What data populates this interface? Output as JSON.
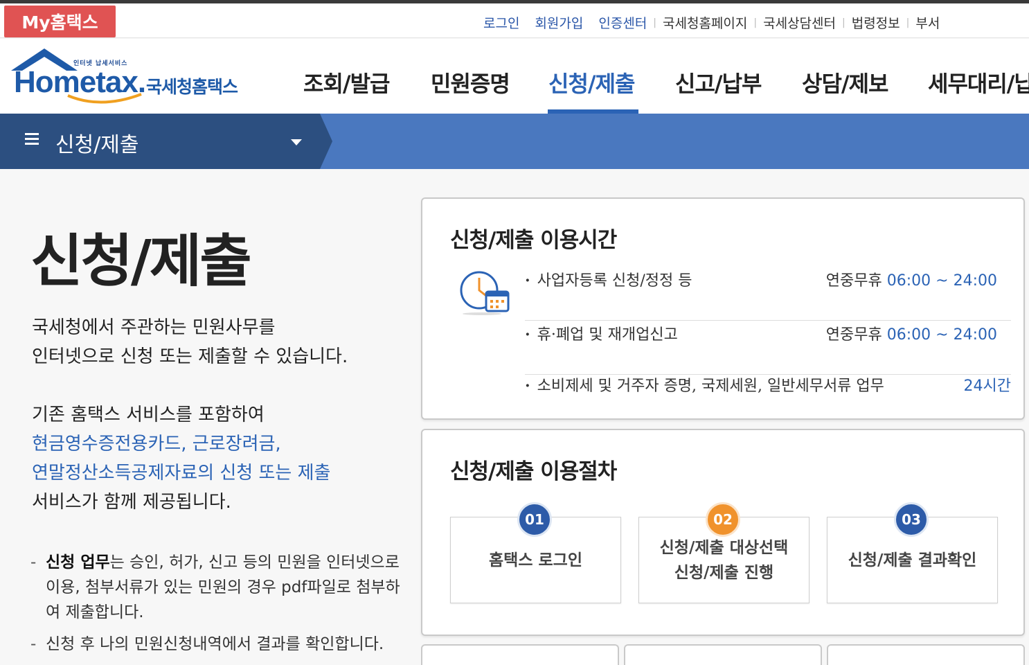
{
  "util": {
    "my_hometax": "My홈택스",
    "links_blue": [
      "로그인",
      "회원가입",
      "인증센터"
    ],
    "links_gray": [
      "국세청홈페이지",
      "국세상담센터",
      "법령정보",
      "부서"
    ]
  },
  "logo": {
    "small_text": "인터넷 납세서비스",
    "brand_en": "Hometax.",
    "brand_kr": "국세청홈택스"
  },
  "gnb": {
    "items": [
      "조회/발급",
      "민원증명",
      "신청/제출",
      "신고/납부",
      "상담/제보",
      "세무대리/납"
    ],
    "active_index": 2
  },
  "subbar": {
    "title": "신청/제출",
    "menu_icon": "hamburger-icon",
    "caret_icon": "caret-down-icon"
  },
  "intro": {
    "title": "신청/제출",
    "p1_line1": "국세청에서 주관하는 민원사무를",
    "p1_line2": "인터넷으로 신청 또는 제출할 수 있습니다.",
    "p2_line1": "기존 홈택스 서비스를 포함하여",
    "p2_blue1": "현금영수증전용카드, 근로장려금,",
    "p2_blue2": "연말정산소득공제자료의 신청 또는 제출",
    "p2_line4": "서비스가 함께 제공됩니다.",
    "bullet1_bold": "신청 업무",
    "bullet1_rest": "는 승인, 허가, 신고 등의 민원을 인터넷으로 이용, 첨부서류가 있는 민원의 경우 pdf파일로 첨부하여 제출합니다.",
    "bullet2": "신청 후 나의 민원신청내역에서 결과를 확인합니다."
  },
  "hours": {
    "title": "신청/제출 이용시간",
    "icon": "clock-calendar-icon",
    "rows": [
      {
        "label": "사업자등록 신청/정정 등",
        "prefix": "연중무휴 ",
        "time": "06:00 ~ 24:00"
      },
      {
        "label": "휴·폐업 및 재개업신고",
        "prefix": "연중무휴 ",
        "time": "06:00 ~ 24:00"
      },
      {
        "label": "소비제세 및 거주자 증명, 국제세원, 일반세무서류 업무",
        "prefix": "",
        "time": "24시간"
      }
    ]
  },
  "procedure": {
    "title": "신청/제출 이용절차",
    "steps": [
      {
        "num": "01",
        "line1": "홈택스 로그인",
        "line2": "",
        "color": "#2d5ba8"
      },
      {
        "num": "02",
        "line1": "신청/제출 대상선택",
        "line2": "신청/제출 진행",
        "color": "#f0922c"
      },
      {
        "num": "03",
        "line1": "신청/제출 결과확인",
        "line2": "",
        "color": "#2d5ba8"
      }
    ]
  },
  "colors": {
    "accent": "#2b63b5",
    "subbar": "#4a78bf",
    "subbar_dark": "#2c4f80",
    "myhome": "#e05353"
  }
}
